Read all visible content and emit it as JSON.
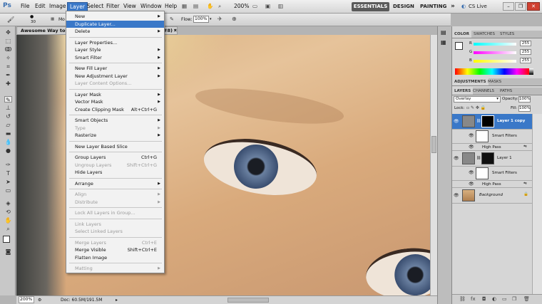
{
  "menubar": {
    "logo": "Ps",
    "items": [
      "File",
      "Edit",
      "Image",
      "Layer",
      "Select",
      "Filter",
      "View",
      "Window",
      "Help"
    ],
    "active": "Layer",
    "zoom": "200%",
    "workspaces": [
      "ESSENTIALS",
      "DESIGN",
      "PAINTING"
    ],
    "more": "»",
    "cs_live": "CS Live"
  },
  "optbar": {
    "brush_size": "30",
    "flow_label": "Flow:",
    "flow_value": "100%",
    "mode_label": "Mo"
  },
  "document": {
    "tab_title": "Awesome Way to Shar",
    "tab_suffix": "#8) *",
    "zoom": "200%",
    "doc_info": "Doc: 60.5M/191.5M"
  },
  "layer_menu": [
    {
      "label": "New",
      "arrow": true
    },
    {
      "label": "Duplicate Layer...",
      "highlight": true
    },
    {
      "label": "Delete",
      "arrow": true
    },
    {
      "sep": true
    },
    {
      "label": "Layer Properties..."
    },
    {
      "label": "Layer Style",
      "arrow": true
    },
    {
      "label": "Smart Filter",
      "arrow": true
    },
    {
      "sep": true
    },
    {
      "label": "New Fill Layer",
      "arrow": true
    },
    {
      "label": "New Adjustment Layer",
      "arrow": true
    },
    {
      "label": "Layer Content Options...",
      "disabled": true
    },
    {
      "sep": true
    },
    {
      "label": "Layer Mask",
      "arrow": true
    },
    {
      "label": "Vector Mask",
      "arrow": true
    },
    {
      "label": "Create Clipping Mask",
      "shortcut": "Alt+Ctrl+G"
    },
    {
      "sep": true
    },
    {
      "label": "Smart Objects",
      "arrow": true
    },
    {
      "label": "Type",
      "arrow": true,
      "disabled": true
    },
    {
      "label": "Rasterize",
      "arrow": true
    },
    {
      "sep": true
    },
    {
      "label": "New Layer Based Slice"
    },
    {
      "sep": true
    },
    {
      "label": "Group Layers",
      "shortcut": "Ctrl+G"
    },
    {
      "label": "Ungroup Layers",
      "shortcut": "Shift+Ctrl+G",
      "disabled": true
    },
    {
      "label": "Hide Layers"
    },
    {
      "sep": true
    },
    {
      "label": "Arrange",
      "arrow": true
    },
    {
      "sep": true
    },
    {
      "label": "Align",
      "arrow": true,
      "disabled": true
    },
    {
      "label": "Distribute",
      "arrow": true,
      "disabled": true
    },
    {
      "sep": true
    },
    {
      "label": "Lock All Layers in Group...",
      "disabled": true
    },
    {
      "sep": true
    },
    {
      "label": "Link Layers",
      "disabled": true
    },
    {
      "label": "Select Linked Layers",
      "disabled": true
    },
    {
      "sep": true
    },
    {
      "label": "Merge Layers",
      "shortcut": "Ctrl+E",
      "disabled": true
    },
    {
      "label": "Merge Visible",
      "shortcut": "Shift+Ctrl+E"
    },
    {
      "label": "Flatten Image"
    },
    {
      "sep": true
    },
    {
      "label": "Matting",
      "arrow": true,
      "disabled": true
    }
  ],
  "color_panel": {
    "tabs": [
      "COLOR",
      "SWATCHES",
      "STYLES"
    ],
    "r_label": "R",
    "g_label": "G",
    "b_label": "B",
    "r": "255",
    "g": "255",
    "b": "255"
  },
  "adjustments_panel": {
    "tabs": [
      "ADJUSTMENTS",
      "MASKS"
    ]
  },
  "layers_panel": {
    "tabs": [
      "LAYERS",
      "CHANNELS",
      "PATHS"
    ],
    "blend_mode": "Overlay",
    "opacity_label": "Opacity:",
    "opacity": "100%",
    "lock_label": "Lock:",
    "fill_label": "Fill:",
    "fill": "100%",
    "layers": [
      {
        "name": "Layer 1 copy",
        "selected": true
      },
      {
        "name": "Smart Filters",
        "sub": true
      },
      {
        "name": "High Pass",
        "sub2": true
      },
      {
        "name": "Layer 1"
      },
      {
        "name": "Smart Filters",
        "sub": true
      },
      {
        "name": "High Pass",
        "sub2": true
      },
      {
        "name": "Background",
        "italic": true
      }
    ]
  },
  "colors": {
    "accent": "#3a78c8"
  }
}
